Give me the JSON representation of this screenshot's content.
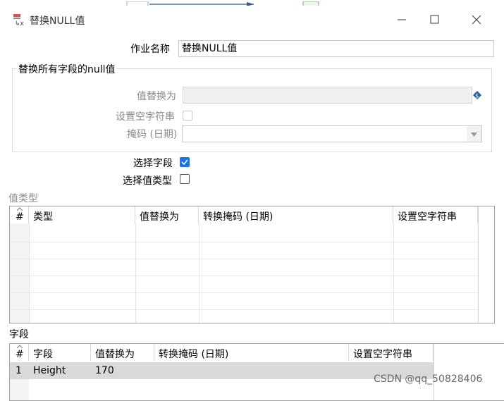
{
  "window": {
    "title": "替换NULL值"
  },
  "form": {
    "job_name_label": "作业名称",
    "job_name_value": "替换NULL值",
    "group_title": "替换所有字段的null值",
    "replace_value_label": "值替换为",
    "set_empty_label": "设置空字符串",
    "mask_label": "掩码 (日期)",
    "select_field_label": "选择字段",
    "select_field_checked": true,
    "select_value_type_label": "选择值类型",
    "select_value_type_checked": false
  },
  "value_type_section": {
    "title": "值类型",
    "columns": [
      "#",
      "类型",
      "值替换为",
      "转换掩码 (日期)",
      "设置空字符串"
    ]
  },
  "fields_section": {
    "title": "字段",
    "columns": [
      "#",
      "字段",
      "值替换为",
      "转换掩码 (日期)",
      "设置空字符串"
    ],
    "rows": [
      {
        "num": "1",
        "field": "Height",
        "replace": "170",
        "mask": "",
        "empty": ""
      }
    ]
  },
  "watermark": "CSDN @qq_50828406",
  "icons": [
    "app-icon",
    "minimize-icon",
    "maximize-icon",
    "close-icon",
    "variable-icon",
    "dropdown-arrow-icon",
    "sort-icon"
  ]
}
